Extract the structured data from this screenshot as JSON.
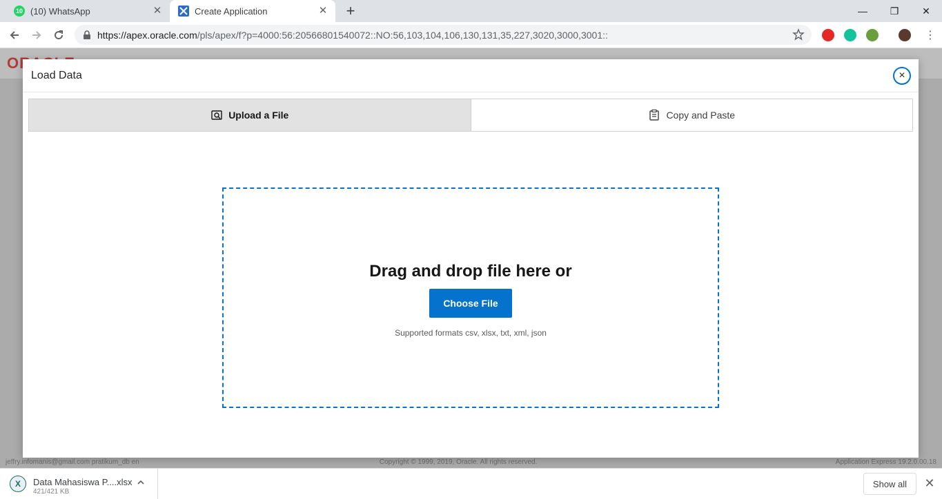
{
  "browser": {
    "tabs": [
      {
        "title": "(10) WhatsApp",
        "badge": "10",
        "icon": "whatsapp-icon",
        "active": false
      },
      {
        "title": "Create Application",
        "icon": "apex-icon",
        "active": true
      }
    ],
    "url_host": "https://apex.oracle.com",
    "url_path": "/pls/apex/f?p=4000:56:20566801540072::NO:56,103,104,106,130,131,35,227,3020,3000,3001::",
    "window_controls": {
      "minimize": "—",
      "restore": "❐",
      "close": "✕"
    },
    "new_tab_label": "+"
  },
  "background_app": {
    "logo_text": "ORACLE",
    "footer_left": "jeffry.infomanis@gmail.com   pratikum_db   en",
    "footer_center": "Copyright © 1999, 2019, Oracle. All rights reserved.",
    "footer_right": "Application Express 19.2.0.00.18"
  },
  "modal": {
    "title": "Load Data",
    "close_label": "×",
    "tabs": [
      {
        "label": "Upload a File",
        "icon": "file-search-icon",
        "selected": true
      },
      {
        "label": "Copy and Paste",
        "icon": "clipboard-icon",
        "selected": false
      }
    ],
    "dropzone": {
      "title": "Drag and drop file here or",
      "button_label": "Choose File",
      "formats": "Supported formats csv, xlsx, txt, xml, json"
    }
  },
  "downloads": {
    "item_name": "Data Mahasiswa P....xlsx",
    "item_size": "421/421 KB",
    "item_icon": "excel-icon",
    "show_all_label": "Show all",
    "close_label": "✕"
  },
  "colors": {
    "accent": "#0572ce",
    "overlay": "#ababab"
  }
}
